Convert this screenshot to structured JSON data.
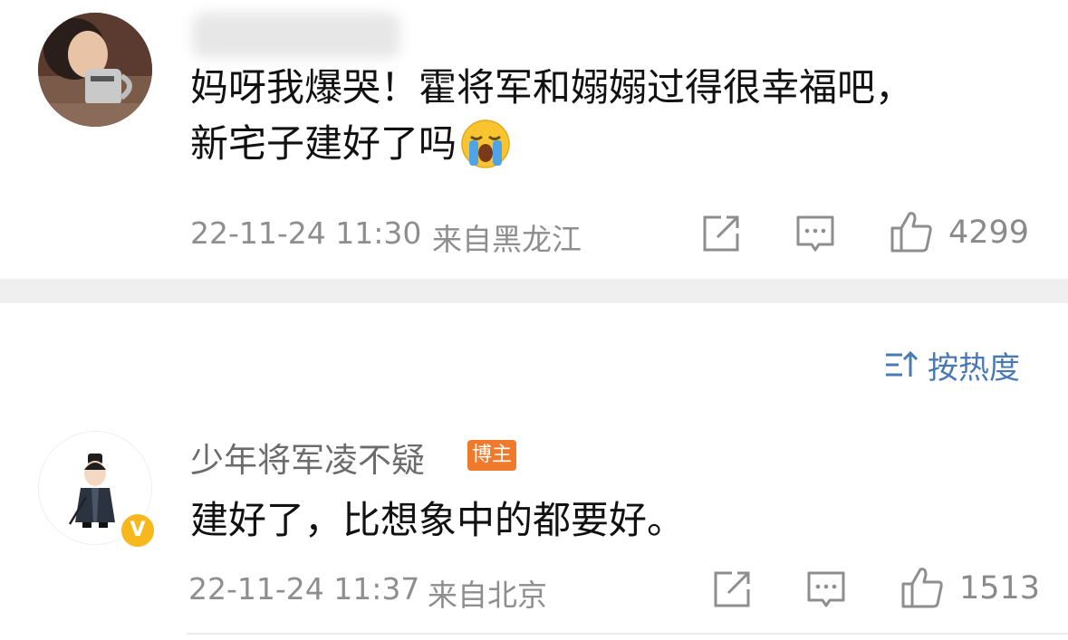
{
  "comment_1": {
    "text_line_1": "妈呀我爆哭！霍将军和嫋嫋过得很幸福吧，",
    "text_line_2": "新宅子建好了吗",
    "emoji_icon": "loudly-crying-face-emoji",
    "timestamp": "22-11-24 11:30",
    "location": "来自黑龙江",
    "likes": "4299"
  },
  "sort": {
    "icon": "sort-descending-icon",
    "label": "按热度"
  },
  "comment_2": {
    "username": "少年将军凌不疑",
    "role_badge": "博主",
    "verified_badge_letter": "V",
    "text": "建好了，比想象中的都要好。",
    "timestamp": "22-11-24 11:37",
    "location": "来自北京",
    "likes": "1513"
  },
  "colors": {
    "meta_gray": "#8e8e8e",
    "sort_blue": "#4a7ab6",
    "badge_orange": "#f07a2b",
    "verified_gold": "#f6b81d",
    "divider_gray": "#efefef"
  }
}
